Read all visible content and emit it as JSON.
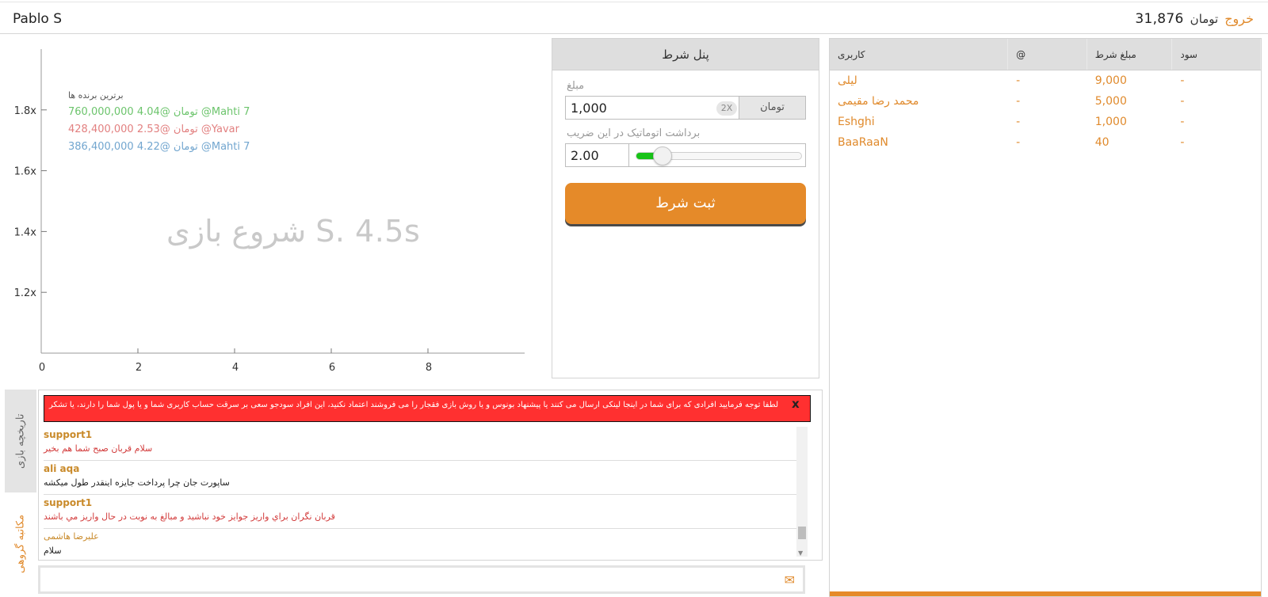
{
  "header": {
    "brand": "Pablo S",
    "balance": "31,876",
    "currency": "تومان",
    "logout_label": "خروج"
  },
  "chart_data": {
    "type": "line",
    "y_ticks": [
      "1.8x",
      "1.6x",
      "1.4x",
      "1.2x"
    ],
    "x_ticks": [
      "0",
      "2",
      "4",
      "6",
      "8"
    ],
    "ylim": [
      1.0,
      2.0
    ],
    "xlim": [
      0,
      10
    ],
    "series": []
  },
  "leaders": {
    "title": "برترین برنده ها",
    "rows": [
      {
        "text": "760,000,000 4.04@ تومان @Mahti 7",
        "color": "#6cc46c"
      },
      {
        "text": "428,400,000 2.53@ تومان @Yavar",
        "color": "#e28080"
      },
      {
        "text": "386,400,000 4.22@ تومان @Mahti 7",
        "color": "#72a6cf"
      }
    ]
  },
  "countdown": "شروع بازی S. 4.5s",
  "bet_panel": {
    "title": "پنل شرط",
    "amount_label": "مبلغ",
    "amount_value": "1,000",
    "x2_label": "2X",
    "amount_currency": "تومان",
    "auto_label": "برداشت اتوماتیک در این ضریب",
    "multiplier_value": "2.00",
    "slider_level": 0.08,
    "submit_label": "ثبت شرط"
  },
  "players": {
    "headers": {
      "user": "کاربری",
      "at": "@",
      "amount": "مبلغ شرط",
      "profit": "سود"
    },
    "rows": [
      {
        "user": "لیلی",
        "at": "-",
        "amount": "9,000",
        "profit": "-"
      },
      {
        "user": "محمد رضا مقیمی",
        "at": "-",
        "amount": "5,000",
        "profit": "-"
      },
      {
        "user": "Eshghi",
        "at": "-",
        "amount": "1,000",
        "profit": "-"
      },
      {
        "user": "BaaRaaN",
        "at": "-",
        "amount": "40",
        "profit": "-"
      }
    ]
  },
  "chat": {
    "tab_history": "تاریخچه بازی",
    "tab_group": "مکاتبه گروهی",
    "alert": "لطفا توجه فرمایید افرادی که برای شما در اینجا لینکی ارسال می کنند یا پیشنهاد بونوس و یا روش بازی فقجار را می فروشند اعتماد نکنید، این افراد سودجو سعی بر سرقت حساب کاربری شما و یا پول شما را دارند، یا تشکر",
    "alert_close": "x",
    "messages": [
      {
        "user": "support1",
        "text": "سلام قربان صبح شما هم بخیر",
        "style": "red"
      },
      {
        "user": "ali aqa",
        "text": "ساپورت جان چرا پرداخت جایزه اینقدر طول میکشه",
        "style": "plain"
      },
      {
        "user": "support1",
        "text": "قربان نگران براي واريز جوايز خود نباشيد و مبالغ به نوبت در حال واريز مي باشند",
        "style": "red"
      },
      {
        "user": "علیرضا هاشمی",
        "text": "سلام",
        "style": "plain"
      }
    ],
    "input_placeholder": ""
  }
}
